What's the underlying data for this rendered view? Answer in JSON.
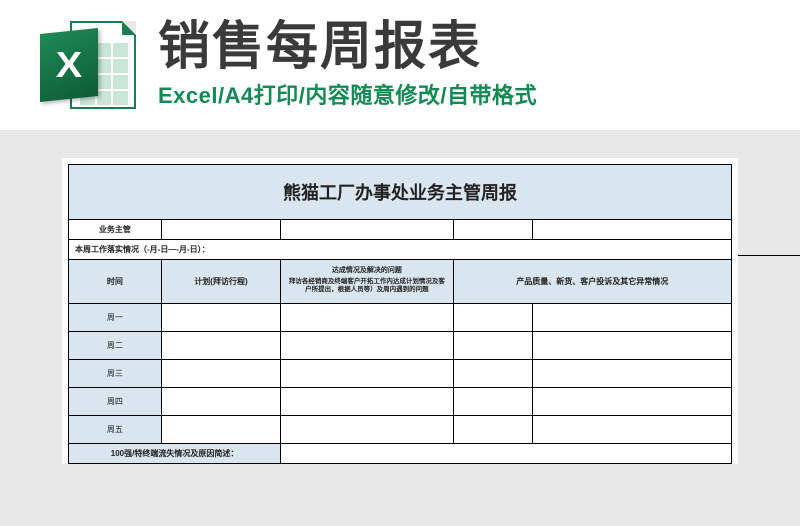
{
  "header": {
    "title": "销售每周报表",
    "subtitle": "Excel/A4打印/内容随意修改/自带格式",
    "icon_letter": "X"
  },
  "sheet": {
    "title": "熊猫工厂办事处业务主管周报",
    "row_supervisor_label": "业务主管",
    "row_week_range_label": "本周工作落实情况（-月-日—-月-日）：",
    "columns": {
      "c1": "时间",
      "c2": "计划(拜访行程)",
      "c3_title": "达成情况及解决的问题",
      "c3_desc": "拜访各经销商及终端客户开拓工作内达成计划情况及客户所提出，根据人员等）及周内遇到的问题",
      "c4": "产品质量、新货、客户投诉及其它异常情况"
    },
    "days": [
      "周一",
      "周二",
      "周三",
      "周四",
      "周五"
    ],
    "footer_row": "100强/特终端流失情况及原因简述："
  }
}
